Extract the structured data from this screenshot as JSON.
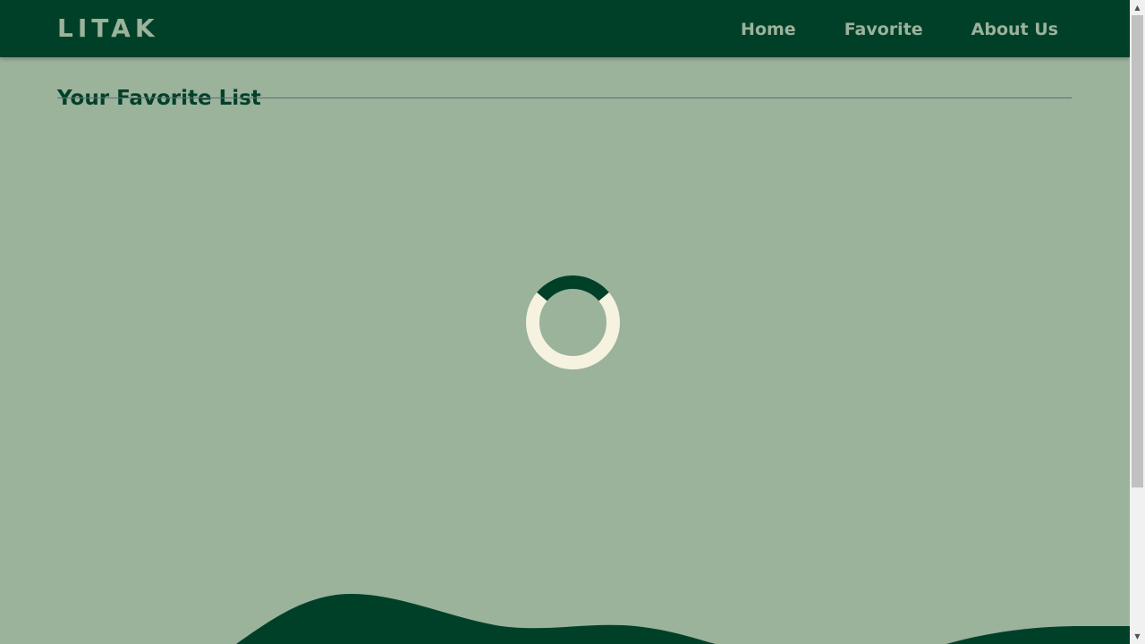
{
  "navbar": {
    "brand": "LITAK",
    "links": [
      {
        "label": "Home"
      },
      {
        "label": "Favorite"
      },
      {
        "label": "About Us"
      }
    ]
  },
  "main": {
    "title": "Your Favorite List",
    "loading": true
  },
  "colors": {
    "primary": "#004029",
    "background": "#9bb29b",
    "spinner_track": "#f5f2e0",
    "spinner_arc": "#004029",
    "divider": "#5d6e7e"
  },
  "icons": {
    "spinner": "loading-spinner-icon",
    "scroll_up": "triangle-up",
    "scroll_down": "triangle-down"
  }
}
